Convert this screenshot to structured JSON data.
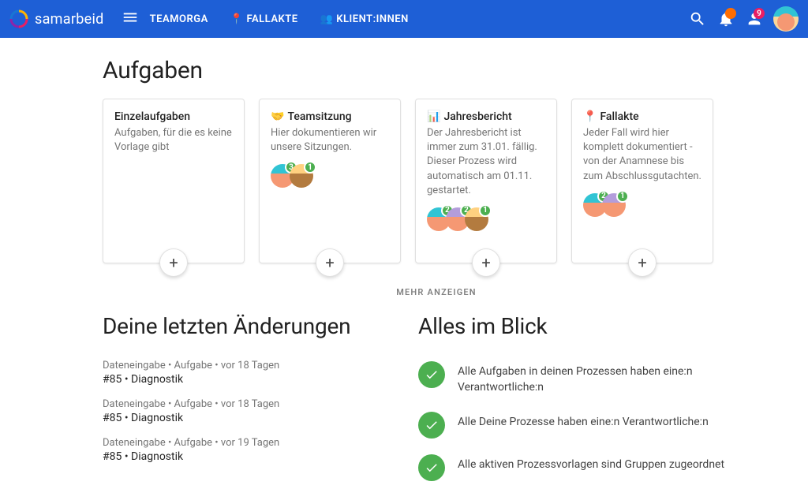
{
  "brand": "samarbeid",
  "nav": {
    "teamorga": "TEAMORGA",
    "fallakte": "FALLAKTE",
    "klient": "KLIENT:INNEN"
  },
  "header_badges": {
    "bell": "",
    "person": "9"
  },
  "sections": {
    "tasks_title": "Aufgaben",
    "more": "MEHR ANZEIGEN",
    "recent_title": "Deine letzten Änderungen",
    "overview_title": "Alles im Blick"
  },
  "cards": [
    {
      "title": "Einzelaufgaben",
      "emoji": "",
      "text": "Aufgaben, für die es keine Vorlage gibt",
      "avatars": []
    },
    {
      "title": "Teamsitzung",
      "emoji": "🤝",
      "text": "Hier dokumentieren wir unsere Sitzungen.",
      "avatars": [
        {
          "k": "av1",
          "n": "3"
        },
        {
          "k": "av2",
          "n": "1"
        }
      ]
    },
    {
      "title": "Jahresbericht",
      "emoji": "📊",
      "text": "Der Jahresbericht ist immer zum 31.01. fällig. Dieser Prozess wird automatisch am 01.11. gestartet.",
      "avatars": [
        {
          "k": "av1",
          "n": "2"
        },
        {
          "k": "av3",
          "n": "2"
        },
        {
          "k": "av2",
          "n": "1"
        }
      ]
    },
    {
      "title": "Fallakte",
      "emoji": "📍",
      "text": "Jeder Fall wird hier komplett dokumentiert - von der Anamnese bis zum Abschlussgutachten.",
      "avatars": [
        {
          "k": "av1",
          "n": "2"
        },
        {
          "k": "av3",
          "n": "1"
        }
      ]
    }
  ],
  "recent": [
    {
      "meta": "Dateneingabe • Aufgabe • vor 18 Tagen",
      "title": "#85 • Diagnostik"
    },
    {
      "meta": "Dateneingabe • Aufgabe • vor 18 Tagen",
      "title": "#85 • Diagnostik"
    },
    {
      "meta": "Dateneingabe • Aufgabe • vor 19 Tagen",
      "title": "#85 • Diagnostik"
    }
  ],
  "overview": [
    "Alle Aufgaben in deinen Prozessen haben eine:n Verantwortliche:n",
    "Alle Deine Prozesse haben eine:n Verantwortliche:n",
    "Alle aktiven Prozessvorlagen sind Gruppen zugeordnet"
  ]
}
